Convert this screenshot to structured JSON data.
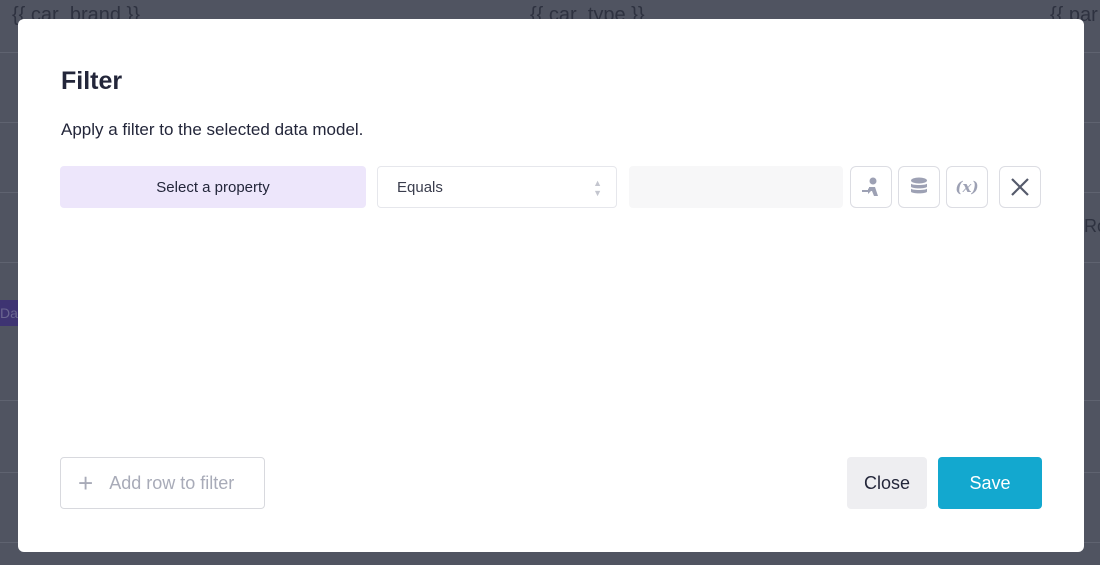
{
  "background": {
    "columns": [
      "{{ car_brand }}",
      "{{ car_type }}",
      "{{ par"
    ],
    "badge": "Da",
    "right_text": "Ro"
  },
  "modal": {
    "title": "Filter",
    "subtitle": "Apply a filter to the selected data model.",
    "row": {
      "property_button": "Select a property",
      "operator": "Equals",
      "value": "",
      "icons": [
        "user-input-icon",
        "database-icon",
        "variable-icon",
        "close-icon"
      ],
      "variable_label": "(x)"
    },
    "add_row_label": "Add row to filter",
    "close_label": "Close",
    "save_label": "Save"
  },
  "colors": {
    "accent": "#13a8cf",
    "property_bg": "#ede6fb"
  }
}
